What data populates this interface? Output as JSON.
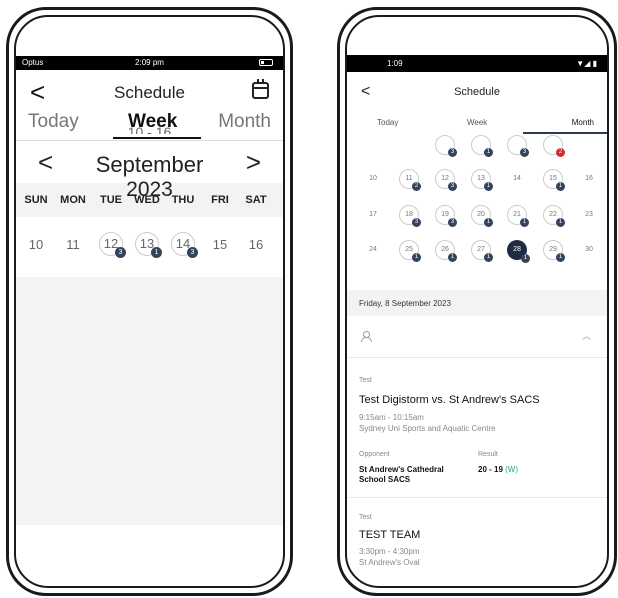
{
  "left": {
    "status": {
      "carrier": "Optus",
      "time": "2:09 pm"
    },
    "header": {
      "back": "<",
      "title": "Schedule"
    },
    "tabs": [
      "Today",
      "Week",
      "Month"
    ],
    "ghost_text": "10 - 16",
    "month_nav": {
      "prev": "<",
      "month": "September",
      "year": "2023",
      "next": ">"
    },
    "weekdays": [
      "SUN",
      "MON",
      "TUE",
      "WED",
      "THU",
      "FRI",
      "SAT"
    ],
    "days": [
      {
        "d": "10"
      },
      {
        "d": "11"
      },
      {
        "d": "12",
        "n": "3"
      },
      {
        "d": "13",
        "n": "1"
      },
      {
        "d": "14",
        "n": "3"
      },
      {
        "d": "15"
      },
      {
        "d": "16"
      }
    ]
  },
  "right": {
    "status": {
      "time": "1:09",
      "icons": "▼◢ ▮"
    },
    "header": {
      "back": "<",
      "title": "Schedule"
    },
    "tabs": [
      "Today",
      "Week",
      "Month"
    ],
    "calendar_rows": [
      [
        {
          "d": "",
          "n": "3"
        },
        {
          "d": "",
          "n": "1"
        },
        {
          "d": "",
          "n": "3"
        },
        {
          "d": "",
          "n": "2",
          "red": true
        }
      ],
      [
        {
          "d": "10"
        },
        {
          "d": "11",
          "n": "2"
        },
        {
          "d": "12",
          "n": "3"
        },
        {
          "d": "13",
          "n": "1"
        },
        {
          "d": "14"
        },
        {
          "d": "15",
          "n": "1"
        },
        {
          "d": "16"
        }
      ],
      [
        {
          "d": "17"
        },
        {
          "d": "18",
          "n": "3"
        },
        {
          "d": "19",
          "n": "3"
        },
        {
          "d": "20",
          "n": "1"
        },
        {
          "d": "21",
          "n": "1"
        },
        {
          "d": "22",
          "n": "1"
        },
        {
          "d": "23"
        }
      ],
      [
        {
          "d": "24"
        },
        {
          "d": "25",
          "n": "1"
        },
        {
          "d": "26",
          "n": "1"
        },
        {
          "d": "27",
          "n": "1"
        },
        {
          "d": "28",
          "n": "1",
          "sel": true
        },
        {
          "d": "29",
          "n": "1"
        },
        {
          "d": "30"
        }
      ]
    ],
    "selected_date": "Friday, 8 September 2023",
    "events": [
      {
        "type": "Test",
        "title": "Test Digistorm vs. St Andrew's SACS",
        "time": "9:15am - 10:15am",
        "venue": "Sydney Uni Sports and Aquatic Centre",
        "opponent_label": "Opponent",
        "opponent_line1": "St Andrew's Cathedral",
        "opponent_line2": "School SACS",
        "result_label": "Result",
        "result": "20 - 19",
        "outcome": "(W)"
      },
      {
        "type": "Test",
        "title": "TEST TEAM",
        "time": "3:30pm - 4:30pm",
        "venue": "St Andrew's Oval"
      }
    ],
    "colors": {
      "navy": "#1f2a44",
      "badge": "#34435c",
      "red": "#d12b2b",
      "win": "#2aa876"
    }
  }
}
